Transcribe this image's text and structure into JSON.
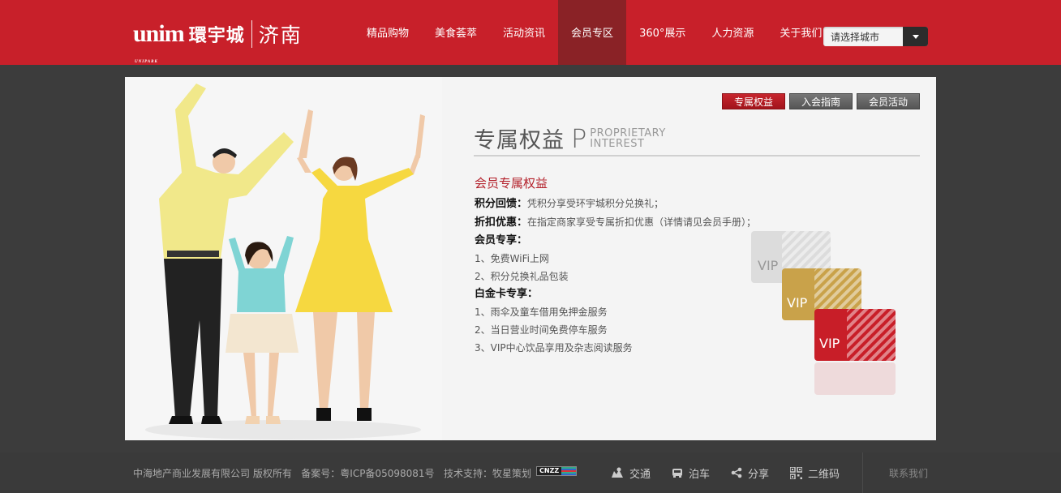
{
  "header": {
    "logo_mark": "unim",
    "logo_sub": "UNIPARK",
    "logo_cn": "環宇城",
    "city": "济南",
    "nav": [
      "精品购物",
      "美食荟萃",
      "活动资讯",
      "会员专区",
      "360°展示",
      "人力资源",
      "关于我们"
    ],
    "active_nav": "会员专区",
    "city_select": "请选择城市"
  },
  "tabs": [
    "专属权益",
    "入会指南",
    "会员活动"
  ],
  "active_tab": "专属权益",
  "section": {
    "title_cn": "专属权益",
    "title_p": "P",
    "title_en_1": "PROPRIETARY",
    "title_en_2": "INTEREST"
  },
  "content": {
    "heading": "会员专属权益",
    "points_label": "积分回馈：",
    "points_text": "凭积分享受环宇城积分兑换礼；",
    "discount_label": "折扣优惠：",
    "discount_text": "在指定商家享受专属折扣优惠（详情请见会员手册）；",
    "member_title": "会员专享：",
    "member_items": [
      "1、免费WiFi上网",
      "2、积分兑换礼品包装"
    ],
    "platinum_title": "白金卡专享：",
    "platinum_items": [
      "1、雨伞及童车借用免押金服务",
      "2、当日营业时间免费停车服务",
      "3、VIP中心饮品享用及杂志阅读服务"
    ]
  },
  "cards": {
    "label": "VIP",
    "colors": [
      "#d9d9d9",
      "#c9a24a",
      "#c81e28"
    ]
  },
  "footer": {
    "copyright": "中海地产商业发展有限公司 版权所有",
    "icp": "备案号：粤ICP备05098081号",
    "tech": "技术支持：牧星策划",
    "cnzz": "CNZZ",
    "links": [
      "交通",
      "泊车",
      "分享",
      "二维码"
    ],
    "contact": "联系我们"
  }
}
